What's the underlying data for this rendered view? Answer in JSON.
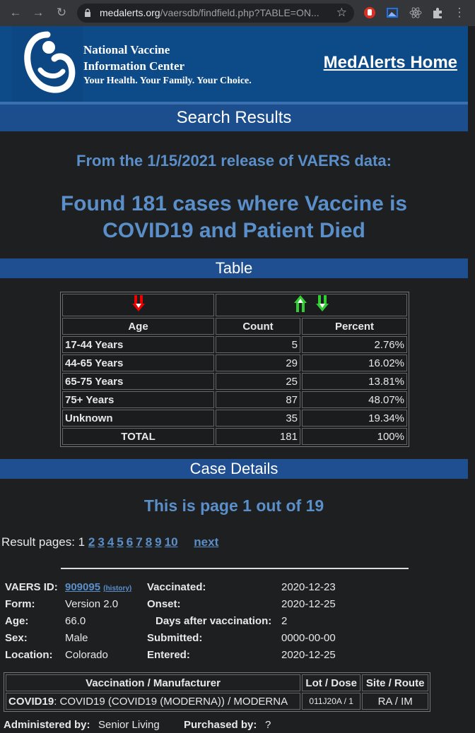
{
  "browser": {
    "url_host": "medalerts.org",
    "url_path": "/vaersdb/findfield.php?TABLE=ON..."
  },
  "header": {
    "org_line1": "National Vaccine",
    "org_line2": "Information Center",
    "org_tagline": "Your Health. Your Family. Your Choice.",
    "home_link": "MedAlerts Home"
  },
  "sections": {
    "search_results": "Search Results",
    "table": "Table",
    "case_details": "Case Details"
  },
  "release_text": "From the 1/15/2021 release of VAERS data:",
  "found_line1": "Found 181 cases where Vaccine is",
  "found_line2": "COVID19 and Patient Died",
  "summary": {
    "headers": [
      "Age",
      "Count",
      "Percent"
    ],
    "rows": [
      {
        "label": "17-44 Years",
        "count": "5",
        "percent": "2.76%"
      },
      {
        "label": "44-65 Years",
        "count": "29",
        "percent": "16.02%"
      },
      {
        "label": "65-75 Years",
        "count": "25",
        "percent": "13.81%"
      },
      {
        "label": "75+ Years",
        "count": "87",
        "percent": "48.07%"
      },
      {
        "label": "Unknown",
        "count": "35",
        "percent": "19.34%"
      }
    ],
    "total": {
      "label": "TOTAL",
      "count": "181",
      "percent": "100%"
    }
  },
  "page_heading": "This is page 1 out of 19",
  "pagination": {
    "label": "Result pages: 1",
    "pages": [
      "2",
      "3",
      "4",
      "5",
      "6",
      "7",
      "8",
      "9",
      "10"
    ],
    "next": "next"
  },
  "case": {
    "vaers_id_label": "VAERS ID:",
    "vaers_id": "909095",
    "history": "(history)",
    "form_label": "Form:",
    "form": "Version 2.0",
    "age_label": "Age:",
    "age": "66.0",
    "sex_label": "Sex:",
    "sex": "Male",
    "location_label": "Location:",
    "location": "Colorado",
    "vaccinated_label": "Vaccinated:",
    "vaccinated": "2020-12-23",
    "onset_label": "Onset:",
    "onset": "2020-12-25",
    "days_label": "Days after vaccination:",
    "days": "2",
    "submitted_label": "Submitted:",
    "submitted": "0000-00-00",
    "entered_label": "Entered:",
    "entered": "2020-12-25"
  },
  "vax_table": {
    "headers": [
      "Vaccination / Manufacturer",
      "Lot / Dose",
      "Site / Route"
    ],
    "vaccine_bold": "COVID19",
    "vaccine_rest": ": COVID19 (COVID19 (MODERNA)) / MODERNA",
    "lot": "011J20A / 1",
    "site": "RA / IM"
  },
  "administered_label": "Administered by:",
  "administered": "Senior Living",
  "purchased_label": "Purchased by:",
  "purchased": "?",
  "colors": {
    "background": "#1d1f21",
    "header_blue": "#0d4a88",
    "accent_text": "#5b8fc9"
  }
}
